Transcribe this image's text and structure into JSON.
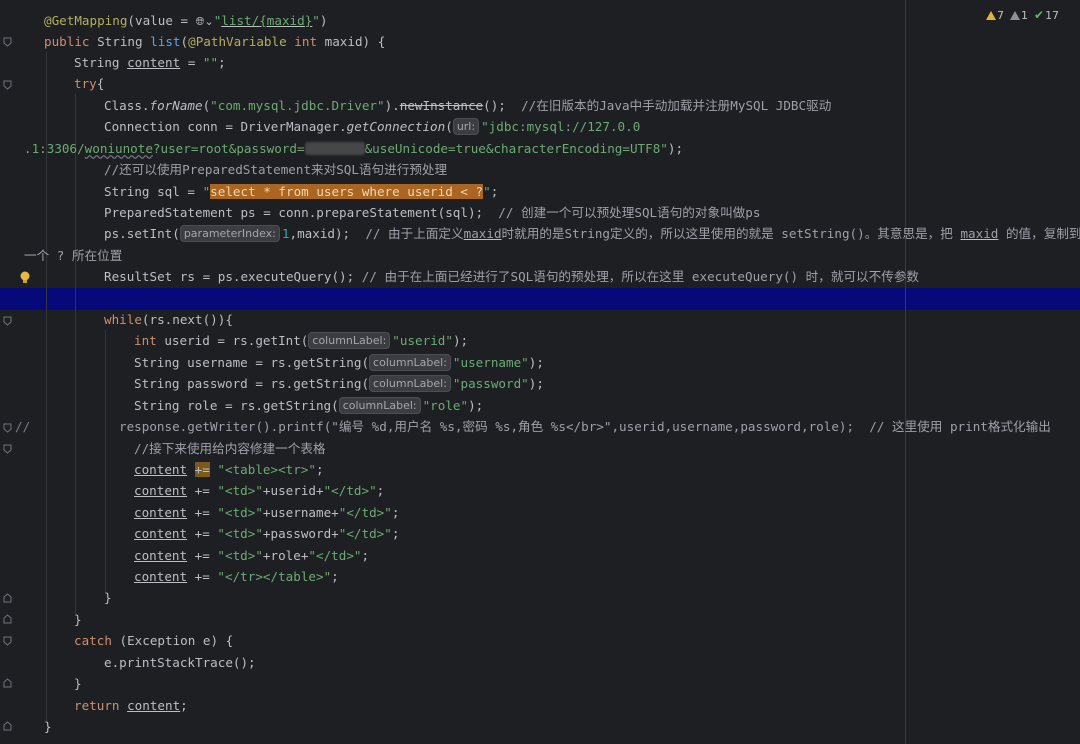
{
  "status": {
    "warnings": "7",
    "weak_warnings": "1",
    "typos": "17"
  },
  "hints": {
    "url": "url:",
    "parameter_index": "parameterIndex:",
    "column_label": "columnLabel:"
  },
  "code": {
    "l1_ann": "@GetMapping",
    "l1_a": "(value = ",
    "l1_b": "\"",
    "l1_c": "list/",
    "l1_d": "{maxid}",
    "l1_e": "\"",
    "l1_f": ")",
    "l2_a": "public",
    "l2_b": " String ",
    "l2_c": "list",
    "l2_d": "(",
    "l2_e": "@PathVariable",
    "l2_f": " ",
    "l2_g": "int",
    "l2_h": " maxid) {",
    "l3_a": "String ",
    "l3_b": "content",
    "l3_c": " = ",
    "l3_d": "\"\"",
    "l3_e": ";",
    "l4_a": "try",
    "l4_b": "{",
    "l5_a": "Class.",
    "l5_b": "forName",
    "l5_c": "(",
    "l5_d": "\"com.mysql.jdbc.Driver\"",
    "l5_e": ").",
    "l5_f": "newInstance",
    "l5_g": "();  ",
    "l5_h": "//在旧版本的Java中手动加载并注册MySQL JDBC驱动",
    "l6_a": "Connection conn = DriverManager.",
    "l6_b": "getConnection",
    "l6_c": "(",
    "l6_d": "\"jdbc:mysql://127.0.0",
    "l7_a": ".1:3306/",
    "l7_b": "woniunote",
    "l7_c": "?user=root&password=",
    "l7_d": "&useUnicode=true&characterEncoding=UTF8\"",
    "l7_e": ");",
    "l8_a": "//还可以使用PreparedStatement来对SQL语句进行预处理",
    "l9_a": "String sql = ",
    "l9_b": "\"",
    "l9_c": "select * from users where userid < ?",
    "l9_d": "\"",
    "l9_e": ";",
    "l10_a": "PreparedStatement ps = conn.prepareStatement(sql);  ",
    "l10_b": "// 创建一个可以预处理SQL语句的对象叫做ps",
    "l11_a": "ps.setInt(",
    "l11_b": "1",
    "l11_c": ",maxid);  ",
    "l11_d": "// 由于上面定义",
    "l11_e": "maxid",
    "l11_f": "时就用的是String定义的，所以这里使用的就是 setString()。其意思是，把 ",
    "l11_g": "maxid",
    "l11_h": " 的值，复制到第",
    "l12_a": "一个 ? 所在位置",
    "l13_a": "ResultSet rs = ps.executeQuery(); ",
    "l13_b": "// 由于在上面已经进行了SQL语句的预处理，所以在这里 executeQuery() 时，就可以不传参数",
    "l15_a": "while",
    "l15_b": "(rs.next()){",
    "l16_a": "int",
    "l16_b": " userid = rs.getInt(",
    "l16_c": "\"userid\"",
    "l16_d": ");",
    "l17_a": "String username = rs.getString(",
    "l17_b": "\"username\"",
    "l17_c": ");",
    "l18_a": "String password = rs.getString(",
    "l18_b": "\"password\"",
    "l18_c": ");",
    "l19_a": "String role = rs.getString(",
    "l19_b": "\"role\"",
    "l19_c": ");",
    "l20_marker": "//",
    "l20_a": "response.getWriter().printf(\"编号 %d,用户名 %s,密码 %s,角色 %s</br>\",userid,username,password,role);  // 这里使用 print格式化输出",
    "l21_a": "//接下来使用给内容修建一个表格",
    "l22_a": "content",
    "l22_b": "+=",
    "l22_c": "\"<table><tr>\"",
    "l22_d": ";",
    "l23_a": "content",
    "l23_b": " += ",
    "l23_c": "\"<td>\"",
    "l23_d": "+userid+",
    "l23_e": "\"</td>\"",
    "l23_f": ";",
    "l24_a": "content",
    "l24_b": " += ",
    "l24_c": "\"<td>\"",
    "l24_d": "+username+",
    "l24_e": "\"</td>\"",
    "l24_f": ";",
    "l25_a": "content",
    "l25_b": " += ",
    "l25_c": "\"<td>\"",
    "l25_d": "+password+",
    "l25_e": "\"</td>\"",
    "l25_f": ";",
    "l26_a": "content",
    "l26_b": " += ",
    "l26_c": "\"<td>\"",
    "l26_d": "+role+",
    "l26_e": "\"</td>\"",
    "l26_f": ";",
    "l27_a": "content",
    "l27_b": " += ",
    "l27_c": "\"</tr></table>\"",
    "l27_d": ";",
    "l28_a": "}",
    "l29_a": "}",
    "l30_a": "catch",
    "l30_b": " (Exception e) {",
    "l31_a": "e.printStackTrace();",
    "l32_a": "}",
    "l33_a": "return",
    "l33_b": " ",
    "l33_c": "content",
    "l33_d": ";",
    "l34_a": "}"
  }
}
